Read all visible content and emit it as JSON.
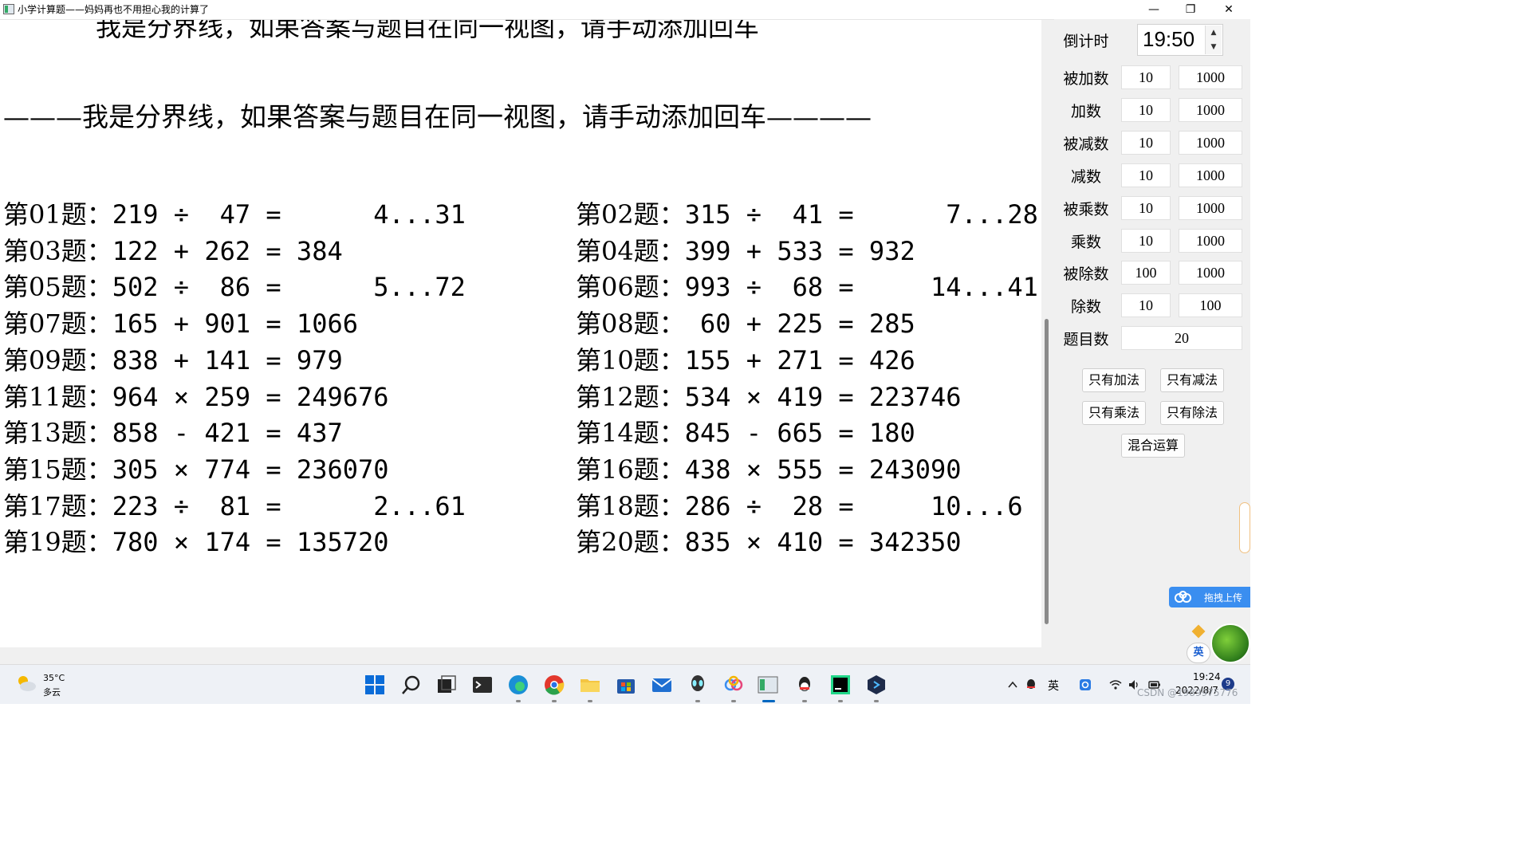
{
  "window": {
    "title": "小学计算题——妈妈再也不用担心我的计算了",
    "minimize_glyph": "—",
    "restore_glyph": "❐",
    "close_glyph": "✕"
  },
  "main": {
    "cut_line": "我是分界线，如果答案与题目在同一视图，请手动添加回车",
    "divider": "———我是分界线，如果答案与题目在同一视图，请手动添加回车————",
    "problems": [
      {
        "label": "第01题：",
        "expr": "219 ÷  47 =      4...31"
      },
      {
        "label": "第02题：",
        "expr": "315 ÷  41 =      7...28"
      },
      {
        "label": "第03题：",
        "expr": "122 + 262 = 384"
      },
      {
        "label": "第04题：",
        "expr": "399 + 533 = 932"
      },
      {
        "label": "第05题：",
        "expr": "502 ÷  86 =      5...72"
      },
      {
        "label": "第06题：",
        "expr": "993 ÷  68 =     14...41"
      },
      {
        "label": "第07题：",
        "expr": "165 + 901 = 1066"
      },
      {
        "label": "第08题：",
        "expr": " 60 + 225 = 285"
      },
      {
        "label": "第09题：",
        "expr": "838 + 141 = 979"
      },
      {
        "label": "第10题：",
        "expr": "155 + 271 = 426"
      },
      {
        "label": "第11题：",
        "expr": "964 × 259 = 249676"
      },
      {
        "label": "第12题：",
        "expr": "534 × 419 = 223746"
      },
      {
        "label": "第13题：",
        "expr": "858 - 421 = 437"
      },
      {
        "label": "第14题：",
        "expr": "845 - 665 = 180"
      },
      {
        "label": "第15题：",
        "expr": "305 × 774 = 236070"
      },
      {
        "label": "第16题：",
        "expr": "438 × 555 = 243090"
      },
      {
        "label": "第17题：",
        "expr": "223 ÷  81 =      2...61"
      },
      {
        "label": "第18题：",
        "expr": "286 ÷  28 =     10...6"
      },
      {
        "label": "第19题：",
        "expr": "780 × 174 = 135720"
      },
      {
        "label": "第20题：",
        "expr": "835 × 410 = 342350"
      }
    ]
  },
  "side": {
    "countdown_label": "倒计时",
    "countdown_value": "19:50",
    "spin_up": "▲",
    "spin_down": "▼",
    "ranges": [
      {
        "label": "被加数",
        "min": "10",
        "max": "1000"
      },
      {
        "label": "加数",
        "min": "10",
        "max": "1000"
      },
      {
        "label": "被减数",
        "min": "10",
        "max": "1000"
      },
      {
        "label": "减数",
        "min": "10",
        "max": "1000"
      },
      {
        "label": "被乘数",
        "min": "10",
        "max": "1000"
      },
      {
        "label": "乘数",
        "min": "10",
        "max": "1000"
      },
      {
        "label": "被除数",
        "min": "100",
        "max": "1000"
      },
      {
        "label": "除数",
        "min": "10",
        "max": "100"
      }
    ],
    "count_label": "题目数",
    "count_value": "20",
    "buttons": {
      "add_only": "只有加法",
      "sub_only": "只有减法",
      "mul_only": "只有乘法",
      "div_only": "只有除法",
      "mixed": "混合运算"
    }
  },
  "overlay": {
    "upload_text": "拖拽上传",
    "ime_text": "英"
  },
  "taskbar": {
    "temperature": "35°C",
    "weather": "多云",
    "ime": "英",
    "time": "19:24",
    "date": "2022/8/7",
    "notifications": "9",
    "watermark": "CSDN @1989975776"
  }
}
